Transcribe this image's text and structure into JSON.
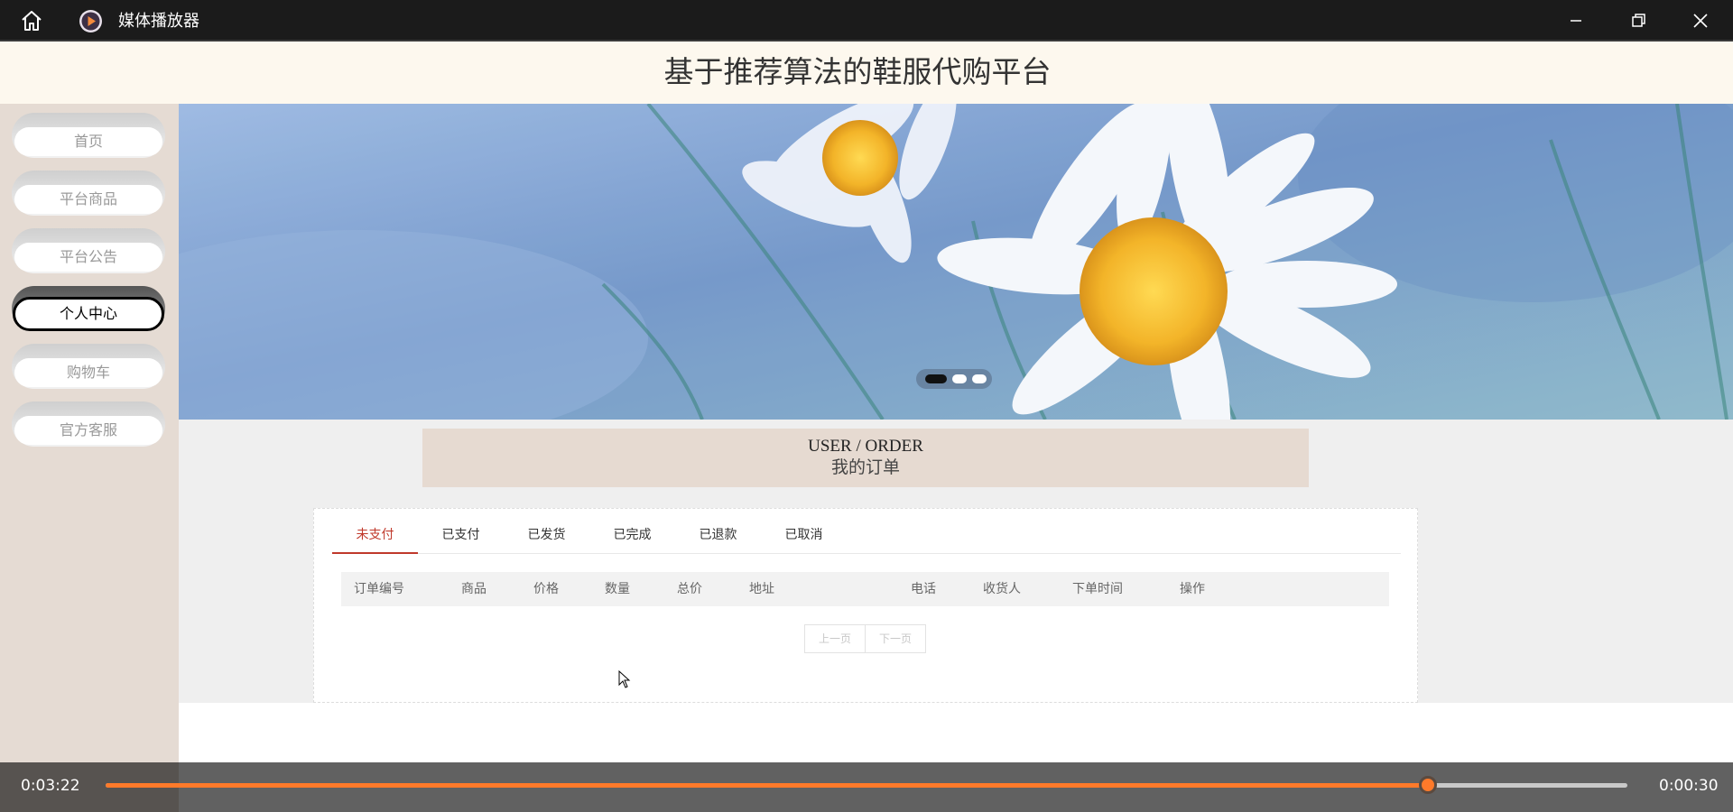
{
  "player": {
    "title": "媒体播放器",
    "time_elapsed": "0:03:22",
    "time_remaining": "0:00:30",
    "progress": 0.869,
    "accent_color": "#ff7a2a",
    "icons": [
      "home-icon",
      "media-player-logo-icon",
      "minimize-icon",
      "restore-icon",
      "close-icon"
    ]
  },
  "site": {
    "title": "基于推荐算法的鞋服代购平台"
  },
  "sidebar": {
    "items": [
      {
        "label": "首页"
      },
      {
        "label": "平台商品"
      },
      {
        "label": "平台公告"
      },
      {
        "label": "个人中心",
        "active": true
      },
      {
        "label": "购物车"
      },
      {
        "label": "官方客服"
      }
    ]
  },
  "banner": {
    "slides": 3,
    "active_slide": 1
  },
  "order_section": {
    "title_en": "USER / ORDER",
    "title_cn": "我的订单"
  },
  "tabs": [
    {
      "label": "未支付",
      "active": true
    },
    {
      "label": "已支付"
    },
    {
      "label": "已发货"
    },
    {
      "label": "已完成"
    },
    {
      "label": "已退款"
    },
    {
      "label": "已取消"
    }
  ],
  "table": {
    "columns": [
      "订单编号",
      "商品",
      "价格",
      "数量",
      "总价",
      "地址",
      "电话",
      "收货人",
      "下单时间",
      "操作"
    ],
    "rows": []
  },
  "pager": {
    "prev_label": "上一页",
    "next_label": "下一页"
  }
}
